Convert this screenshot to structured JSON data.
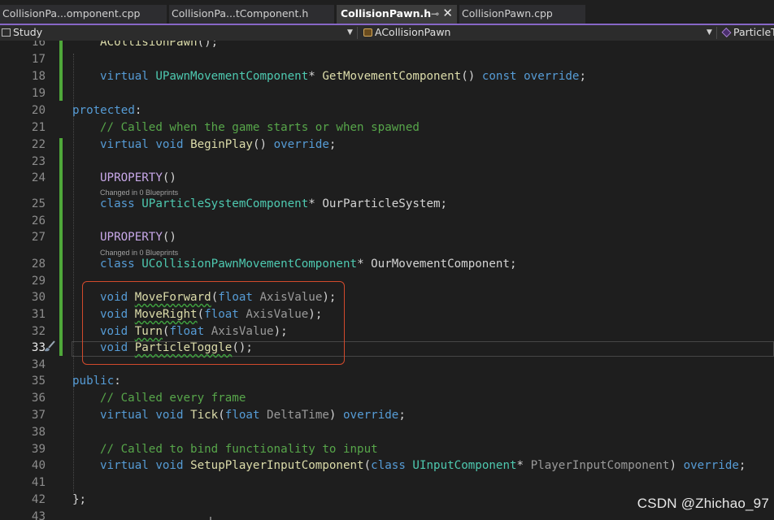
{
  "tabs": [
    {
      "label": "CollisionPa...omponent.cpp",
      "active": false
    },
    {
      "label": "CollisionPa...tComponent.h",
      "active": false
    },
    {
      "label": "CollisionPawn.h",
      "active": true,
      "pin_icon": "pin-icon",
      "close_icon": "close-icon"
    },
    {
      "label": "CollisionPawn.cpp",
      "active": false
    }
  ],
  "nav": {
    "project": "Study",
    "class_scope": "ACollisionPawn",
    "member": "ParticleT"
  },
  "codelens": {
    "uproperty_hint": "Changed in 0 Blueprints"
  },
  "code": {
    "l16": {
      "num": "16",
      "fn": "ACollisionPawn",
      "rest": "();"
    },
    "l17": {
      "num": "17"
    },
    "l18": {
      "num": "18",
      "kw1": "virtual",
      "type": "UPawnMovementComponent",
      "star": "*",
      "fn": "GetMovementComponent",
      "parens": "()",
      "kw2": "const",
      "kw3": "override",
      "end": ";"
    },
    "l19": {
      "num": "19"
    },
    "l20": {
      "num": "20",
      "kw": "protected",
      "end": ":"
    },
    "l21": {
      "num": "21",
      "comment": "// Called when the game starts or when spawned"
    },
    "l22": {
      "num": "22",
      "kw1": "virtual",
      "kw2": "void",
      "fn": "BeginPlay",
      "parens": "()",
      "kw3": "override",
      "end": ";"
    },
    "l23": {
      "num": "23"
    },
    "l24": {
      "num": "24",
      "macro": "UPROPERTY",
      "parens": "()"
    },
    "l25": {
      "num": "25",
      "kw": "class",
      "type": "UParticleSystemComponent",
      "rest": "* OurParticleSystem;"
    },
    "l26": {
      "num": "26"
    },
    "l27": {
      "num": "27",
      "macro": "UPROPERTY",
      "parens": "()"
    },
    "l28": {
      "num": "28",
      "kw": "class",
      "type": "UCollisionPawnMovementComponent",
      "rest": "* OurMovementComponent;"
    },
    "l29": {
      "num": "29"
    },
    "l30": {
      "num": "30",
      "kw": "void",
      "fn": "MoveForward",
      "open": "(",
      "kw2": "float",
      "param": "AxisValue",
      "close": ");"
    },
    "l31": {
      "num": "31",
      "kw": "void",
      "fn": "MoveRight",
      "open": "(",
      "kw2": "float",
      "param": "AxisValue",
      "close": ");"
    },
    "l32": {
      "num": "32",
      "kw": "void",
      "fn": "Turn",
      "open": "(",
      "kw2": "float",
      "param": "AxisValue",
      "close": ");"
    },
    "l33": {
      "num": "33",
      "kw": "void",
      "fn": "ParticleToggle",
      "rest": "();"
    },
    "l34": {
      "num": "34"
    },
    "l35": {
      "num": "35",
      "kw": "public",
      "end": ":"
    },
    "l36": {
      "num": "36",
      "comment": "// Called every frame"
    },
    "l37": {
      "num": "37",
      "kw1": "virtual",
      "kw2": "void",
      "fn": "Tick",
      "open": "(",
      "kw3": "float",
      "param": "DeltaTime",
      "close": ")",
      "kw4": "override",
      "end": ";"
    },
    "l38": {
      "num": "38"
    },
    "l39": {
      "num": "39",
      "comment": "// Called to bind functionality to input"
    },
    "l40": {
      "num": "40",
      "kw1": "virtual",
      "kw2": "void",
      "fn": "SetupPlayerInputComponent",
      "open": "(",
      "kw3": "class",
      "type": "UInputComponent",
      "star": "*",
      "param": "PlayerInputComponent",
      "close": ")",
      "kw4": "override",
      "end": ";"
    },
    "l41": {
      "num": "41"
    },
    "l42": {
      "num": "42",
      "text": "};"
    },
    "l43": {
      "num": "43"
    }
  },
  "watermark": "CSDN @Zhichao_97",
  "colors": {
    "keyword": "#569cd6",
    "type": "#4ec9b0",
    "function": "#dcdcaa",
    "macro": "#c8a8e9",
    "comment": "#57a64a",
    "highlight_box": "#d24a2c",
    "change_bar": "#4fa83a",
    "tab_accent": "#8767c7"
  }
}
